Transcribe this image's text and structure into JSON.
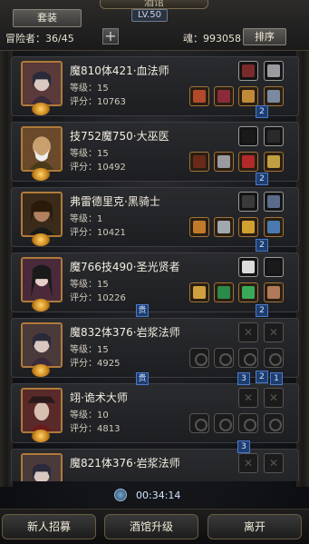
{
  "header": {
    "title": "酒馆",
    "tab_label": "套装",
    "level": "LV.50",
    "adventurers_label": "冒险者：36/45",
    "soul_label": "魂：993058",
    "sort_label": "排序"
  },
  "heroes": [
    {
      "name": "魔810体421·血法师",
      "level": "等级：15",
      "score": "评分：10763"
    },
    {
      "name": "技752魔750·大巫医",
      "level": "等级：15",
      "score": "评分：10492"
    },
    {
      "name": "弗雷德里克·黑骑士",
      "level": "等级：1",
      "score": "评分：10421"
    },
    {
      "name": "魔766技490·圣光贤者",
      "level": "等级：15",
      "score": "评分：10226"
    },
    {
      "name": "魔832体376·岩浆法师",
      "level": "等级：15",
      "score": "评分：4925"
    },
    {
      "name": "翊·诡术大师",
      "level": "等级：10",
      "score": "评分：4813"
    },
    {
      "name": "魔821体376·岩浆法师",
      "level": "",
      "score": ""
    }
  ],
  "connectors": [
    "2",
    "2",
    "2",
    "2",
    "贵",
    "2",
    "3",
    "1",
    "贵",
    "3"
  ],
  "timer": "00:34:14",
  "bottom": {
    "recruit": "新人招募",
    "upgrade": "酒馆升级",
    "leave": "离开"
  }
}
